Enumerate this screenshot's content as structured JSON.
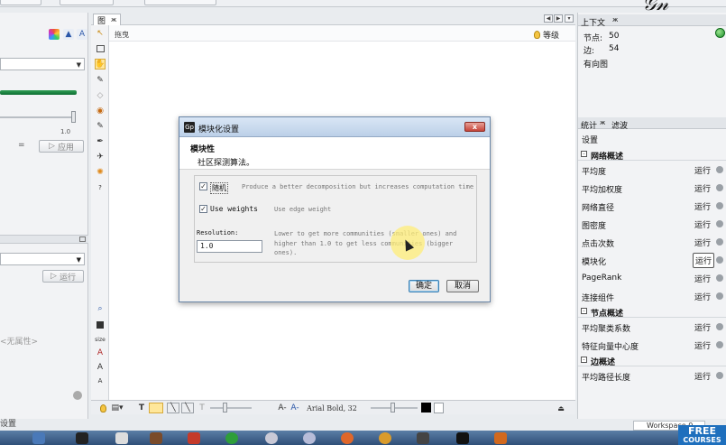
{
  "graph_panel": {
    "tab_label": "图",
    "tab_close": "ж",
    "header_label": "拖曳",
    "degree_label": "等级",
    "nav_left": "◀",
    "nav_right": "▶",
    "nav_menu": "▾"
  },
  "left_panel": {
    "slider_value": "1.0",
    "apply_button": "应用",
    "run_button": "运行",
    "no_attribute": "<无属性>",
    "status_text": "设置"
  },
  "dialog": {
    "title": "模块化设置",
    "close_label": "x",
    "heading": "模块性",
    "subheading": "社区探测算法。",
    "random_label": "随机",
    "random_checked": true,
    "random_desc": "Produce a better decomposition but increases computation time",
    "weights_label": "Use weights",
    "weights_checked": true,
    "weights_desc": "Use edge weight",
    "resolution_label": "Resolution:",
    "resolution_value": "1.0",
    "resolution_desc_line1": "Lower to get more communities (smaller ones) and",
    "resolution_desc_line2": "higher than 1.0 to get less communities (bigger ones).",
    "ok_button": "确定",
    "cancel_button": "取消"
  },
  "bottom_toolbar": {
    "font_label": "Arial Bold, 32"
  },
  "context_panel": {
    "title": "上下文",
    "close": "ж",
    "nodes_label": "节点:",
    "nodes_value": "50",
    "edges_label": "边:",
    "edges_value": "54",
    "graph_type": "有向图"
  },
  "statistics_panel": {
    "tab_stats": "统计",
    "tab_filter": "滤波",
    "settings_label": "设置",
    "sections": [
      {
        "title": "网络概述",
        "items": [
          {
            "name": "平均度",
            "action": "运行"
          },
          {
            "name": "平均加权度",
            "action": "运行"
          },
          {
            "name": "网络直径",
            "action": "运行"
          },
          {
            "name": "图密度",
            "action": "运行"
          },
          {
            "name": "点击次数",
            "action": "运行"
          },
          {
            "name": "模块化",
            "action": "运行"
          },
          {
            "name": "PageRank",
            "action": "运行"
          },
          {
            "name": "连接组件",
            "action": "运行"
          }
        ]
      },
      {
        "title": "节点概述",
        "items": [
          {
            "name": "平均聚类系数",
            "action": "运行"
          },
          {
            "name": "特征向量中心度",
            "action": "运行"
          }
        ]
      },
      {
        "title": "边概述",
        "items": [
          {
            "name": "平均路径长度",
            "action": "运行"
          }
        ]
      }
    ]
  },
  "workspace_label": "Workspace 0",
  "free_badge": {
    "line1": "FREE",
    "line2": "COURSES"
  }
}
